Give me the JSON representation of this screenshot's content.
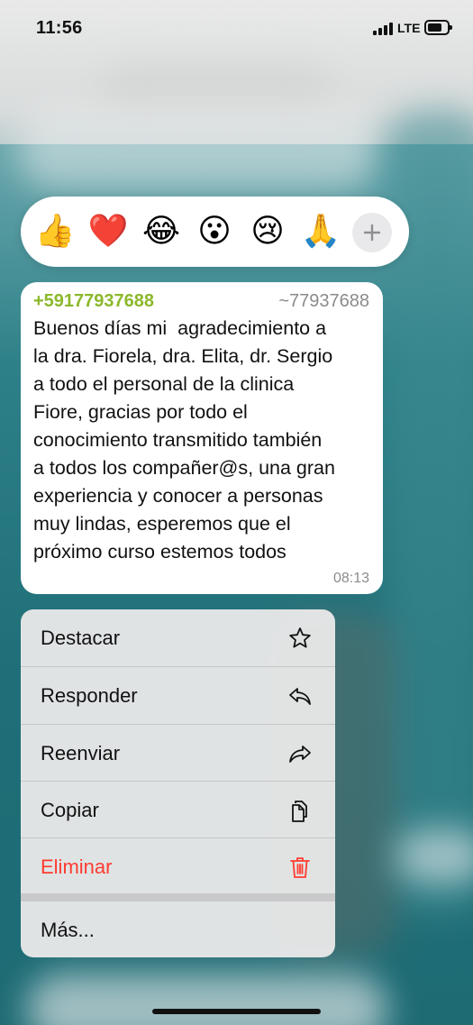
{
  "status_bar": {
    "time": "11:56",
    "network": "LTE"
  },
  "reactions": {
    "emojis": [
      "👍",
      "❤️",
      "😂",
      "😮",
      "😢",
      "🙏"
    ],
    "more_icon": "plus-icon"
  },
  "message": {
    "sender_phone": "+59177937688",
    "sender_alias": "~77937688",
    "text": "Buenos días mi  agradecimiento a\nla dra. Fiorela, dra. Elita, dr. Sergio\na todo el personal de la clinica\nFiore, gracias por todo el\nconocimiento transmitido también\na todos los compañer@s, una gran\nexperiencia y conocer a personas\nmuy lindas, esperemos que el\npróximo curso estemos todos",
    "time": "08:13"
  },
  "menu": {
    "items": [
      {
        "label": "Destacar",
        "icon": "star-icon"
      },
      {
        "label": "Responder",
        "icon": "reply-icon"
      },
      {
        "label": "Reenviar",
        "icon": "forward-icon"
      },
      {
        "label": "Copiar",
        "icon": "copy-icon"
      },
      {
        "label": "Eliminar",
        "icon": "trash-icon"
      }
    ],
    "more": {
      "label": "Más..."
    }
  },
  "colors": {
    "sender": "#8cb82b",
    "danger": "#ff3b30",
    "backdrop": "#2f7f86"
  }
}
